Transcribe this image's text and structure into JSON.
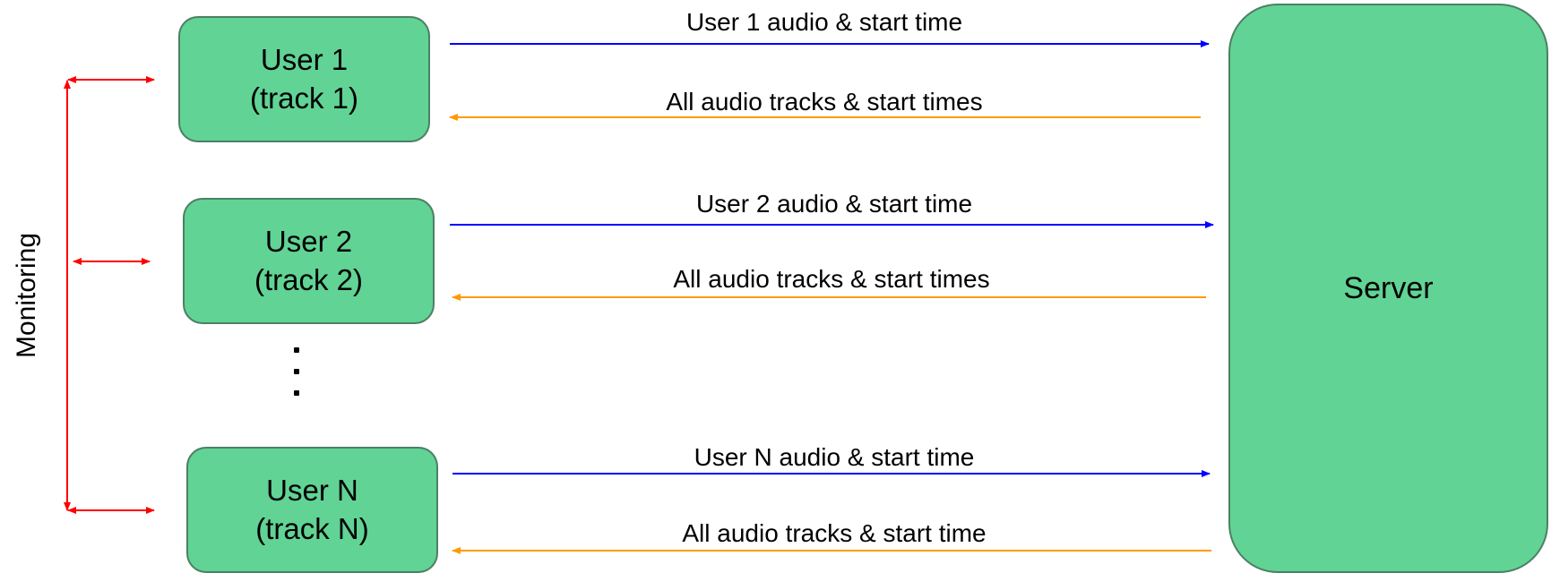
{
  "users": [
    {
      "name": "User 1",
      "track": "(track 1)"
    },
    {
      "name": "User 2",
      "track": "(track 2)"
    },
    {
      "name": "User N",
      "track": "(track N)"
    }
  ],
  "server": {
    "label": "Server"
  },
  "arrows": [
    {
      "label": "User 1 audio & start time",
      "direction": "to-server",
      "color": "#0000ff"
    },
    {
      "label": "All audio tracks & start times",
      "direction": "to-user",
      "color": "#ff9900"
    },
    {
      "label": "User 2 audio & start time",
      "direction": "to-server",
      "color": "#0000ff"
    },
    {
      "label": "All audio tracks & start times",
      "direction": "to-user",
      "color": "#ff9900"
    },
    {
      "label": "User N audio & start time",
      "direction": "to-server",
      "color": "#0000ff"
    },
    {
      "label": "All audio tracks & start time",
      "direction": "to-user",
      "color": "#ff9900"
    }
  ],
  "monitoring": {
    "label": "Monitoring",
    "color": "#ff0000"
  },
  "colors": {
    "box_fill": "#61d395",
    "upload": "#0000ff",
    "download": "#ff9900",
    "monitor": "#ff0000"
  }
}
